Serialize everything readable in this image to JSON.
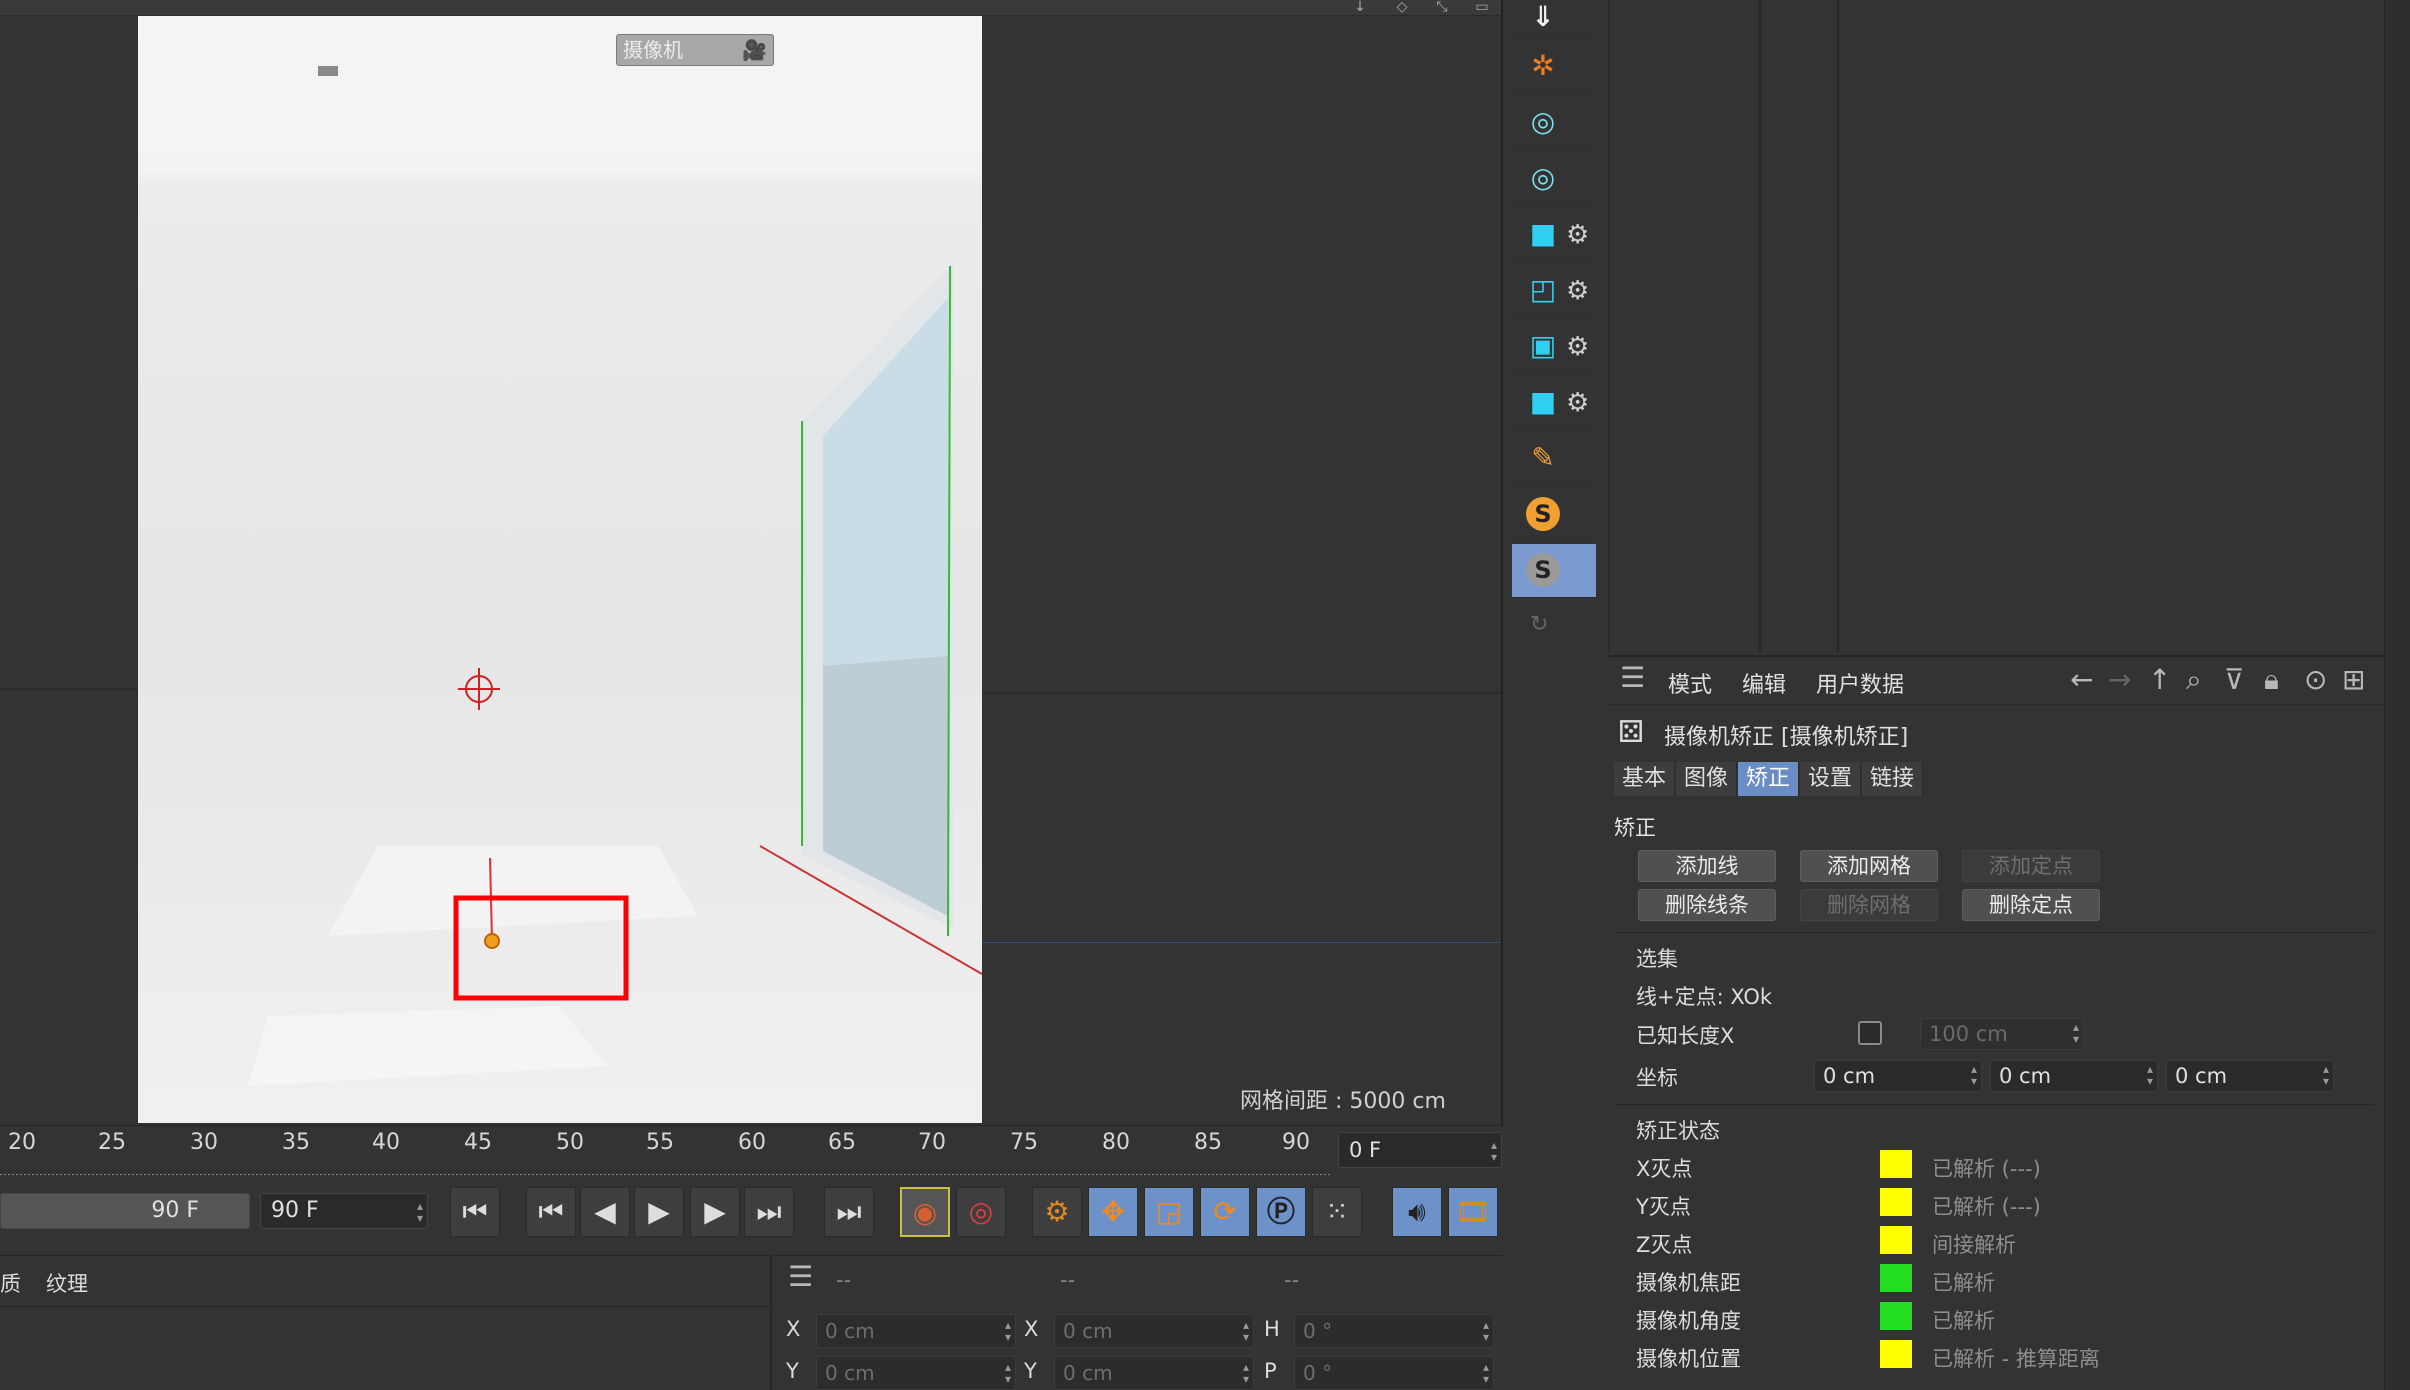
{
  "viewport": {
    "camera_label": "摄像机",
    "grid_spacing": "网格间距 : 5000 cm"
  },
  "toolstrip": {
    "items": [
      {
        "icon": "download-arrow-icon"
      },
      {
        "icon": "vanishing-point-icon"
      },
      {
        "icon": "boole-intersect-icon"
      },
      {
        "icon": "boole-union-icon"
      },
      {
        "icon": "cloner-copy-icon"
      },
      {
        "icon": "subtract-shape-icon"
      },
      {
        "icon": "inset-shape-icon"
      },
      {
        "icon": "duplicate-shape-icon"
      },
      {
        "icon": "pencil-spline-icon"
      },
      {
        "icon": "s-orange-icon",
        "glyph": "S"
      },
      {
        "icon": "s-grey-icon",
        "glyph": "S"
      }
    ]
  },
  "attr": {
    "menu": [
      "模式",
      "编辑",
      "用户数据"
    ],
    "title": "摄像机矫正 [摄像机矫正]",
    "tabs": [
      "基本",
      "图像",
      "矫正",
      "设置",
      "链接"
    ],
    "active_tab": "矫正",
    "section_correct": "矫正",
    "buttons": {
      "add_line": "添加线",
      "add_grid": "添加网格",
      "add_point": "添加定点",
      "del_lines": "删除线条",
      "del_grid": "删除网格",
      "del_point": "删除定点"
    },
    "selection": {
      "title": "选集",
      "line_point": "线+定点: XOk",
      "known_length": "已知长度X",
      "known_length_value": "100 cm",
      "coord_label": "坐标",
      "coords": [
        "0 cm",
        "0 cm",
        "0 cm"
      ]
    },
    "status": {
      "title": "矫正状态",
      "rows": [
        {
          "label": "X灭点",
          "status": "已解析 (---)",
          "color": "#ffff00"
        },
        {
          "label": "Y灭点",
          "status": "已解析 (---)",
          "color": "#ffff00"
        },
        {
          "label": "Z灭点",
          "status": "间接解析",
          "color": "#ffff00"
        },
        {
          "label": "摄像机焦距",
          "status": "已解析",
          "color": "#22dd22"
        },
        {
          "label": "摄像机角度",
          "status": "已解析",
          "color": "#22dd22"
        },
        {
          "label": "摄像机位置",
          "status": "已解析 - 推算距离",
          "color": "#ffff00"
        }
      ]
    }
  },
  "timeline": {
    "ticks": [
      "20",
      "25",
      "30",
      "35",
      "40",
      "45",
      "50",
      "55",
      "60",
      "65",
      "70",
      "75",
      "80",
      "85",
      "90"
    ],
    "current_frame": "0 F"
  },
  "transport": {
    "end_frame_a": "90 F",
    "end_frame_b": "90 F"
  },
  "bottom": {
    "mat_tabs": [
      "质",
      "纹理"
    ],
    "coord_header": [
      "--",
      "--",
      "--"
    ],
    "rows": [
      {
        "l1": "X",
        "v1": "0 cm",
        "l2": "X",
        "v2": "0 cm",
        "l3": "H",
        "v3": "0 °"
      },
      {
        "l1": "Y",
        "v1": "0 cm",
        "l2": "Y",
        "v2": "0 cm",
        "l3": "P",
        "v3": "0 °"
      }
    ]
  },
  "colors": {
    "active_blue": "#6b8cc4",
    "highlight_red": "#ff0000"
  }
}
